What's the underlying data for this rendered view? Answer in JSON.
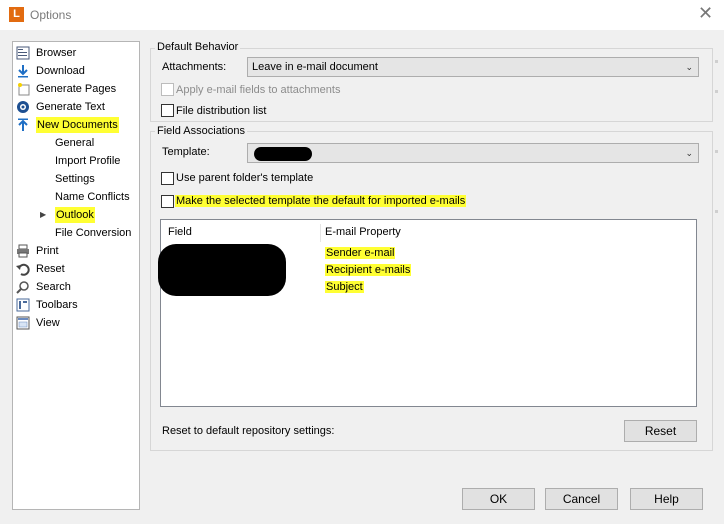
{
  "window": {
    "app_icon_letter": "L",
    "title": "Options",
    "close_glyph": "✕"
  },
  "nav": {
    "items": [
      {
        "label": "Browser",
        "icon": "browser-icon"
      },
      {
        "label": "Download",
        "icon": "download-arrow-icon"
      },
      {
        "label": "Generate Pages",
        "icon": "generate-pages-icon"
      },
      {
        "label": "Generate Text",
        "icon": "generate-text-icon"
      },
      {
        "label": "New Documents",
        "icon": "upload-arrow-icon"
      },
      {
        "label": "Print",
        "icon": "printer-icon"
      },
      {
        "label": "Reset",
        "icon": "undo-icon"
      },
      {
        "label": "Search",
        "icon": "magnifier-icon"
      },
      {
        "label": "Toolbars",
        "icon": "toolbars-icon"
      },
      {
        "label": "View",
        "icon": "view-icon"
      }
    ],
    "sub_items": [
      {
        "label": "General"
      },
      {
        "label": "Import Profile"
      },
      {
        "label": "Settings"
      },
      {
        "label": "Name Conflicts"
      },
      {
        "label": "Outlook"
      },
      {
        "label": "File Conversion"
      }
    ],
    "expand_glyph": "▶"
  },
  "default_behavior": {
    "title": "Default Behavior",
    "attachments_label": "Attachments:",
    "attachments_value": "Leave in e-mail document",
    "apply_fields_label": "Apply e-mail fields to attachments",
    "file_distribution_label": "File distribution list"
  },
  "field_associations": {
    "title": "Field Associations",
    "template_label": "Template:",
    "use_parent_label": "Use parent folder's template",
    "make_default_label": "Make the selected template the default for imported e-mails",
    "columns": {
      "field": "Field",
      "property": "E-mail Property"
    },
    "rows": [
      {
        "property": "Sender e-mail"
      },
      {
        "property": "Recipient e-mails"
      },
      {
        "property": "Subject"
      }
    ],
    "reset_label": "Reset to default repository settings:",
    "reset_button": "Reset"
  },
  "footer": {
    "ok": "OK",
    "cancel": "Cancel",
    "help": "Help"
  },
  "colors": {
    "highlight": "#ffff33",
    "app_icon": "#e26b10"
  }
}
